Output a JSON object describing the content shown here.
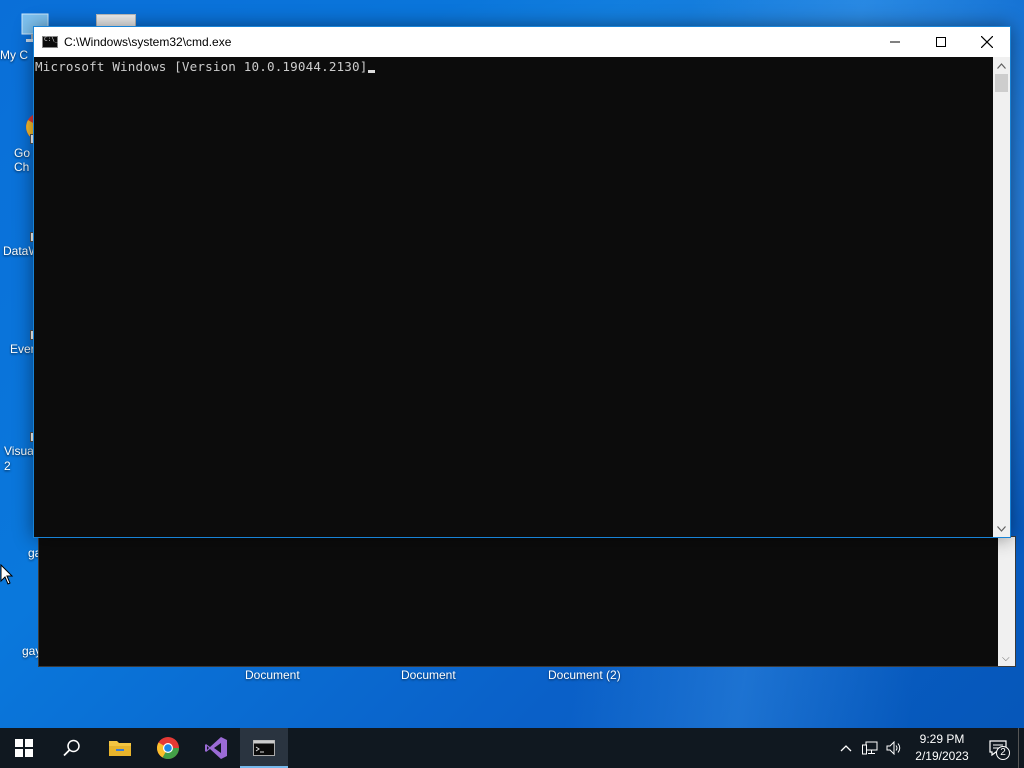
{
  "window": {
    "title": "C:\\Windows\\system32\\cmd.exe",
    "console_text": "Microsoft Windows [Version 10.0.19044.2130]"
  },
  "desktop": {
    "icons": [
      {
        "label": "My C",
        "icon": "computer-icon"
      },
      {
        "label": "Go\nCh",
        "icon": "chrome-icon"
      },
      {
        "label": "DataW",
        "icon": "datawrapper-icon"
      },
      {
        "label": "Ever",
        "icon": "evernote-icon"
      },
      {
        "label": "Visua\n2",
        "icon": "visual-studio-icon"
      },
      {
        "label": "ga",
        "icon": "settings-file-icon"
      },
      {
        "label": "gay",
        "icon": "settings-file-icon"
      }
    ],
    "bottom_labels": [
      "Document",
      "Document",
      "Document (2)"
    ]
  },
  "taskbar": {
    "items": [
      "start-icon",
      "search-icon",
      "file-explorer-icon",
      "chrome-icon",
      "visual-studio-icon",
      "cmd-icon"
    ],
    "time": "9:29 PM",
    "date": "2/19/2023",
    "notification_count": "2"
  },
  "colors": {
    "console_bg": "#0c0c0c",
    "console_fg": "#cccccc",
    "taskbar_bg": "#101820",
    "desktop_blue": "#0a6fd8"
  }
}
